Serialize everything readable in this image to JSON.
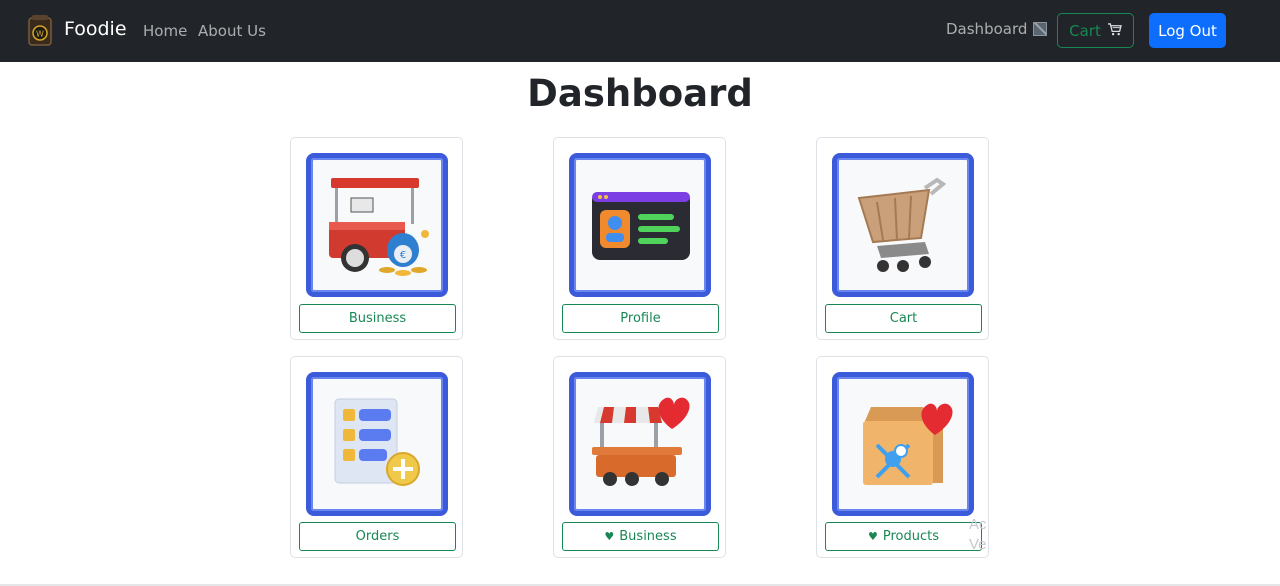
{
  "navbar": {
    "brand": "Foodie",
    "links": {
      "home": "Home",
      "about": "About Us",
      "dashboard": "Dashboard"
    },
    "cart_label": "Cart",
    "logout_label": "Log Out",
    "icons": {
      "logo": "foodie-logo-icon",
      "dashboard_image": "broken-image-icon",
      "cart": "shopping-cart-icon"
    }
  },
  "page": {
    "title": "Dashboard"
  },
  "cards": [
    {
      "label": "Business",
      "icon": "food-cart-money-icon"
    },
    {
      "label": "Profile",
      "icon": "profile-card-icon"
    },
    {
      "label": "Cart",
      "icon": "shopping-cart-icon"
    },
    {
      "label": "Orders",
      "icon": "order-list-add-icon"
    },
    {
      "label": "Business",
      "icon": "favorite-food-stall-icon",
      "heart": "♥"
    },
    {
      "label": "Products",
      "icon": "favorite-food-bag-icon",
      "heart": "♥"
    }
  ],
  "watermark": {
    "line1": "Ac",
    "line2": "Ve"
  },
  "colors": {
    "navbar_bg": "#212529",
    "success": "#198754",
    "primary": "#0d6efd",
    "thumb_border": "#3b5bdb"
  }
}
